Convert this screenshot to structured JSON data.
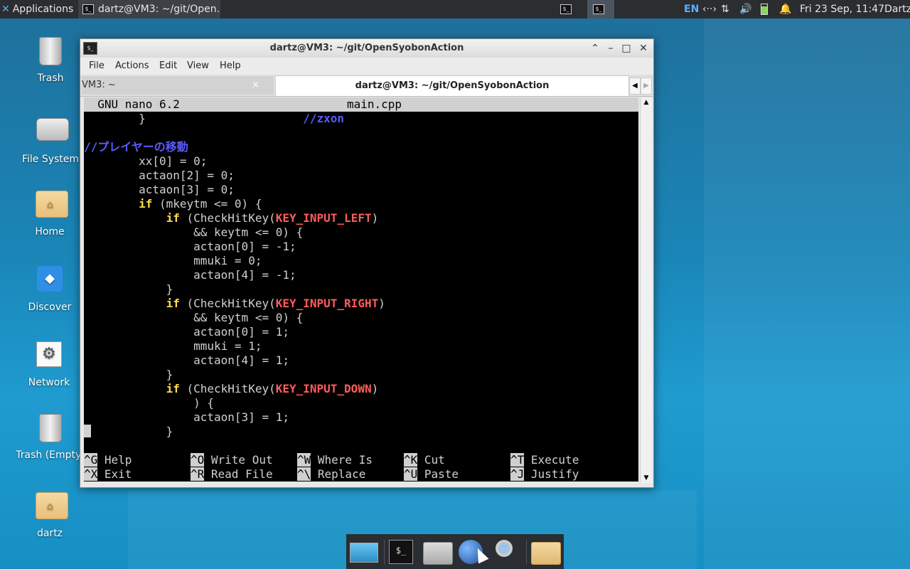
{
  "panel": {
    "apps_label": "Applications",
    "task_label": "dartz@VM3: ~/git/Open...",
    "lang": "EN",
    "net_glyph": "‹··›",
    "arrows_glyph": "⇅",
    "vol_glyph": "🔊",
    "clock": "Fri 23 Sep, 11:47",
    "user": "Dartz"
  },
  "desktop": {
    "icons": [
      {
        "label": "Trash"
      },
      {
        "label": "File System"
      },
      {
        "label": "Home"
      },
      {
        "label": "Discover"
      },
      {
        "label": "Network"
      },
      {
        "label": "Trash (Empty)"
      },
      {
        "label": "dartz"
      }
    ]
  },
  "window": {
    "title": "dartz@VM3: ~/git/OpenSyobonAction",
    "menu": [
      "File",
      "Actions",
      "Edit",
      "View",
      "Help"
    ],
    "tabs": [
      {
        "label": "VM3: ~",
        "close": "×"
      },
      {
        "label": "dartz@VM3: ~/git/OpenSyobonAction"
      }
    ]
  },
  "nano": {
    "version": "  GNU nano 6.2",
    "filename": "main.cpp",
    "lines": {
      "l1_pre": "        }                       ",
      "l1_c": "//zxon",
      "l3_c": "//プレイヤーの移動",
      "l4": "        xx[0] = 0;",
      "l5": "        actaon[2] = 0;",
      "l6": "        actaon[3] = 0;",
      "l7_kw": "if",
      "l7_rest": " (mkeytm <= 0) {",
      "l8_kw": "if",
      "l8_a": " (CheckHitKey(",
      "l8_mac": "KEY_INPUT_LEFT",
      "l8_b": ")",
      "l9": "                && keytm <= 0) {",
      "l10": "                actaon[0] = -1;",
      "l11": "                mmuki = 0;",
      "l12": "                actaon[4] = -1;",
      "l13": "            }",
      "l14_kw": "if",
      "l14_a": " (CheckHitKey(",
      "l14_mac": "KEY_INPUT_RIGHT",
      "l14_b": ")",
      "l15": "                && keytm <= 0) {",
      "l16": "                actaon[0] = 1;",
      "l17": "                mmuki = 1;",
      "l18": "                actaon[4] = 1;",
      "l19": "            }",
      "l20_kw": "if",
      "l20_a": " (CheckHitKey(",
      "l20_mac": "KEY_INPUT_DOWN",
      "l20_b": ")",
      "l21": "                ) {",
      "l22": "                actaon[3] = 1;",
      "l23": "            }"
    },
    "shortcuts": [
      {
        "key": "^G",
        "label": " Help"
      },
      {
        "key": "^O",
        "label": " Write Out"
      },
      {
        "key": "^W",
        "label": " Where Is"
      },
      {
        "key": "^K",
        "label": " Cut"
      },
      {
        "key": "^T",
        "label": " Execute"
      },
      {
        "key": "^X",
        "label": " Exit"
      },
      {
        "key": "^R",
        "label": " Read File"
      },
      {
        "key": "^\\",
        "label": " Replace"
      },
      {
        "key": "^U",
        "label": " Paste"
      },
      {
        "key": "^J",
        "label": " Justify"
      }
    ]
  },
  "colors": {
    "keyword": "#ffdd44",
    "macro": "#ff5c5c",
    "comment": "#5a5aff"
  }
}
